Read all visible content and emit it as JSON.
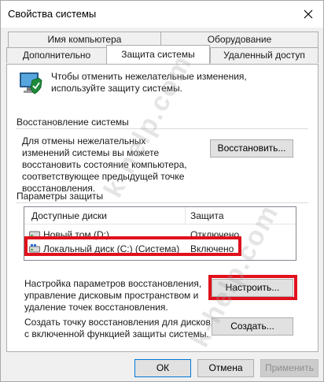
{
  "window": {
    "title": "Свойства системы"
  },
  "tabs": {
    "row1": [
      "Имя компьютера",
      "Оборудование"
    ],
    "row2": [
      "Дополнительно",
      "Защита системы",
      "Удаленный доступ"
    ],
    "active": "Защита системы"
  },
  "intro": {
    "icon": "computer-shield-icon",
    "text": "Чтобы отменить нежелательные изменения, используйте защиту системы."
  },
  "restore": {
    "title": "Восстановление системы",
    "description": "Для отмены нежелательных изменений системы вы можете восстановить состояние компьютера, соответствующее предыдущей точке восстановления.",
    "button": "Восстановить..."
  },
  "protection": {
    "title": "Параметры защиты",
    "columns": [
      "Доступные диски",
      "Защита"
    ],
    "disks": [
      {
        "name": "Новый том (D:)",
        "status": "Отключено",
        "icon": "drive-icon"
      },
      {
        "name": "Локальный диск (C:) (Система)",
        "status": "Включено",
        "icon": "system-drive-icon"
      }
    ]
  },
  "configure": {
    "description": "Настройка параметров восстановления, управление дисковым пространством и удаление точек восстановления.",
    "button": "Настроить..."
  },
  "create": {
    "description": "Создать точку восстановления для дисков с включенной функцией защиты системы.",
    "button": "Создать..."
  },
  "footer": {
    "ok": "ОК",
    "cancel": "Отмена",
    "apply": "Применить"
  },
  "watermark": "k-help.com",
  "colors": {
    "highlight": "#e0101c",
    "focus": "#0078d7"
  }
}
